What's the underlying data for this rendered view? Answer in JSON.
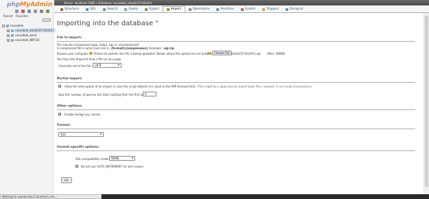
{
  "logo": {
    "php": "php",
    "admin": "MyAdmin"
  },
  "nav": {
    "tabs": [
      "Recent",
      "Favorites"
    ],
    "tree": {
      "root": "cacvebde",
      "items": [
        "cacvebde_b5ad2357442451",
        "cacvebde_word",
        "cacvebde_WPCSV"
      ]
    }
  },
  "serverbar": {
    "text": "Server: localhost:3306 » Database: cacvebde_b5ad2357442451"
  },
  "tabs": [
    {
      "label": "Structure",
      "icon": "structure-icon",
      "color": "#8a6a3a"
    },
    {
      "label": "SQL",
      "icon": "sql-icon",
      "color": "#5b8ac7"
    },
    {
      "label": "Search",
      "icon": "search-icon",
      "color": "#6a8fb8"
    },
    {
      "label": "Query",
      "icon": "query-icon",
      "color": "#7aa0c4"
    },
    {
      "label": "Export",
      "icon": "export-icon",
      "color": "#6b9a4f"
    },
    {
      "label": "Import",
      "icon": "import-icon",
      "color": "#6b9a4f"
    },
    {
      "label": "Operations",
      "icon": "wrench-icon",
      "color": "#8a8a8a"
    },
    {
      "label": "Routines",
      "icon": "routines-icon",
      "color": "#6a8fb8"
    },
    {
      "label": "Events",
      "icon": "events-icon",
      "color": "#c45a5a"
    },
    {
      "label": "Triggers",
      "icon": "triggers-icon",
      "color": "#c4a44a"
    },
    {
      "label": "Designer",
      "icon": "designer-icon",
      "color": "#6a8fb8"
    }
  ],
  "page": {
    "title": "Importing into the database \"",
    "file": {
      "legend": "File to import:",
      "compress_note": "File may be compressed (gzip, bzip2, zip) or uncompressed.",
      "compress_note2_a": "A compressed file's name must end in ",
      "compress_note2_b": ".[format].[compression]",
      "compress_note2_c": ". Example: ",
      "compress_note2_d": ".sql.zip",
      "browse_text": "Browse your computer:",
      "upload_note": "Please be patient, the file is being uploaded. Details about the upload are not available.",
      "choose_button": "Choose File",
      "chosen_file": "b5ad2357442451.sql",
      "max_size": "(Max: 50MiB)",
      "drag_note": "You may also drag and drop a file on any page.",
      "charset_label": "Character set of the file:",
      "charset_value": "utf-8"
    },
    "partial": {
      "legend": "Partial import:",
      "interrupt_label": "Allow the interruption of an import in case the script detects it is close to the PHP timeout limit.",
      "interrupt_note": "(This might be a good way to import large files, however it can break transactions.)",
      "skip_label": "Skip this number of queries (for SQL) starting from the first one:",
      "skip_value": "0"
    },
    "other": {
      "legend": "Other options:",
      "fk_label": "Enable foreign key checks"
    },
    "format": {
      "legend": "Format:",
      "value": "SQL"
    },
    "format_specific": {
      "legend": "Format-specific options:",
      "compat_label": "SQL compatibility mode:",
      "compat_value": "NONE",
      "auto_inc_label": "Do not use AUTO_INCREMENT for zero values"
    },
    "go_button": "Go"
  },
  "statusbar": {
    "text": "Waiting for pandar.bou1.bluehost.com..."
  }
}
